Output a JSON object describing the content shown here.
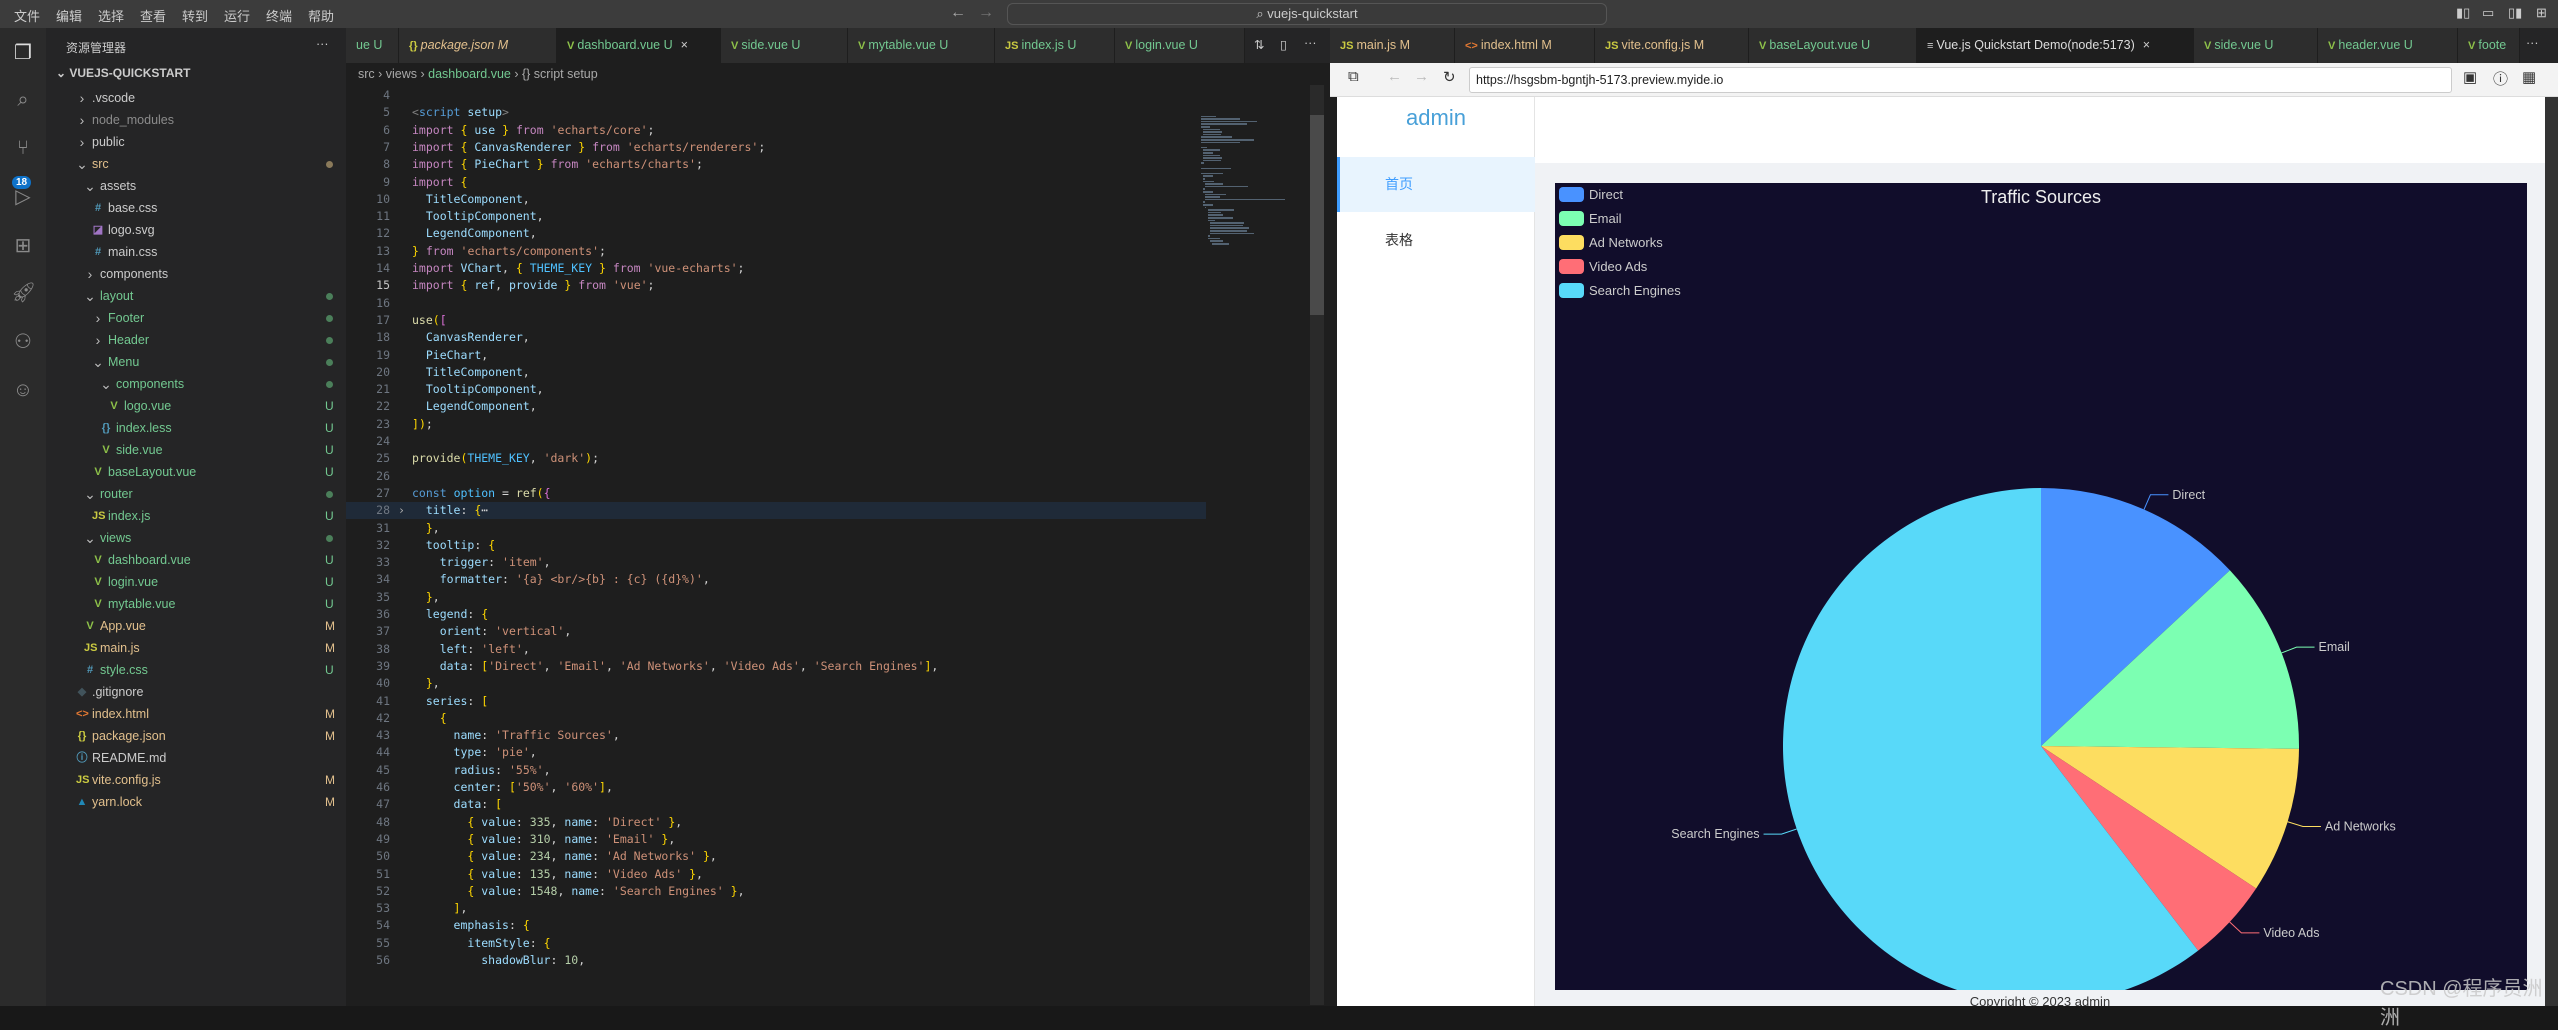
{
  "titlebar": {
    "menu": [
      "文件",
      "编辑",
      "选择",
      "查看",
      "转到",
      "运行",
      "终端",
      "帮助"
    ],
    "search": "vuejs-quickstart"
  },
  "activity_bar": {
    "scm_badge": "18"
  },
  "explorer": {
    "title": "资源管理器",
    "more": "···",
    "root": "VUEJS-QUICKSTART",
    "items": [
      {
        "name": ".vscode",
        "level": 1,
        "type": "folder",
        "open": false,
        "color": "default"
      },
      {
        "name": "node_modules",
        "level": 1,
        "type": "folder",
        "open": false,
        "color": "dim"
      },
      {
        "name": "public",
        "level": 1,
        "type": "folder",
        "open": false,
        "color": "default"
      },
      {
        "name": "src",
        "level": 1,
        "type": "folder",
        "open": true,
        "color": "o",
        "dot": "#8a7a5a"
      },
      {
        "name": "assets",
        "level": 2,
        "type": "folder",
        "open": true,
        "color": "default"
      },
      {
        "name": "base.css",
        "level": 3,
        "type": "file",
        "icon": "#",
        "iconColor": "#519aba",
        "color": "default"
      },
      {
        "name": "logo.svg",
        "level": 3,
        "type": "file",
        "icon": "◪",
        "iconColor": "#a074c4",
        "color": "default"
      },
      {
        "name": "main.css",
        "level": 3,
        "type": "file",
        "icon": "#",
        "iconColor": "#519aba",
        "color": "default"
      },
      {
        "name": "components",
        "level": 2,
        "type": "folder",
        "open": false,
        "color": "default"
      },
      {
        "name": "layout",
        "level": 2,
        "type": "folder",
        "open": true,
        "color": "g",
        "dot": "#4b7f5a"
      },
      {
        "name": "Footer",
        "level": 3,
        "type": "folder",
        "open": false,
        "color": "g",
        "dot": "#4b7f5a"
      },
      {
        "name": "Header",
        "level": 3,
        "type": "folder",
        "open": false,
        "color": "g",
        "dot": "#4b7f5a"
      },
      {
        "name": "Menu",
        "level": 3,
        "type": "folder",
        "open": true,
        "color": "g",
        "dot": "#4b7f5a"
      },
      {
        "name": "components",
        "level": 4,
        "type": "folder",
        "open": true,
        "color": "g",
        "dot": "#4b7f5a"
      },
      {
        "name": "logo.vue",
        "level": 5,
        "type": "file",
        "icon": "V",
        "iconColor": "#8dc149",
        "color": "g",
        "status": "U"
      },
      {
        "name": "index.less",
        "level": 4,
        "type": "file",
        "icon": "{}",
        "iconColor": "#519aba",
        "color": "g",
        "status": "U"
      },
      {
        "name": "side.vue",
        "level": 4,
        "type": "file",
        "icon": "V",
        "iconColor": "#8dc149",
        "color": "g",
        "status": "U"
      },
      {
        "name": "baseLayout.vue",
        "level": 3,
        "type": "file",
        "icon": "V",
        "iconColor": "#8dc149",
        "color": "g",
        "status": "U"
      },
      {
        "name": "router",
        "level": 2,
        "type": "folder",
        "open": true,
        "color": "g",
        "dot": "#4b7f5a"
      },
      {
        "name": "index.js",
        "level": 3,
        "type": "file",
        "icon": "JS",
        "iconColor": "#cbcb41",
        "color": "g",
        "status": "U"
      },
      {
        "name": "views",
        "level": 2,
        "type": "folder",
        "open": true,
        "color": "g",
        "dot": "#4b7f5a"
      },
      {
        "name": "dashboard.vue",
        "level": 3,
        "type": "file",
        "icon": "V",
        "iconColor": "#8dc149",
        "color": "g",
        "status": "U"
      },
      {
        "name": "login.vue",
        "level": 3,
        "type": "file",
        "icon": "V",
        "iconColor": "#8dc149",
        "color": "g",
        "status": "U"
      },
      {
        "name": "mytable.vue",
        "level": 3,
        "type": "file",
        "icon": "V",
        "iconColor": "#8dc149",
        "color": "g",
        "status": "U"
      },
      {
        "name": "App.vue",
        "level": 2,
        "type": "file",
        "icon": "V",
        "iconColor": "#8dc149",
        "color": "o",
        "status": "M"
      },
      {
        "name": "main.js",
        "level": 2,
        "type": "file",
        "icon": "JS",
        "iconColor": "#cbcb41",
        "color": "o",
        "status": "M"
      },
      {
        "name": "style.css",
        "level": 2,
        "type": "file",
        "icon": "#",
        "iconColor": "#519aba",
        "color": "g",
        "status": "U"
      },
      {
        "name": ".gitignore",
        "level": 1,
        "type": "file",
        "icon": "◆",
        "iconColor": "#41535b",
        "color": "default"
      },
      {
        "name": "index.html",
        "level": 1,
        "type": "file",
        "icon": "<>",
        "iconColor": "#e37933",
        "color": "o",
        "status": "M"
      },
      {
        "name": "package.json",
        "level": 1,
        "type": "file",
        "icon": "{}",
        "iconColor": "#cbcb41",
        "color": "o",
        "status": "M"
      },
      {
        "name": "README.md",
        "level": 1,
        "type": "file",
        "icon": "ⓘ",
        "iconColor": "#519aba",
        "color": "default"
      },
      {
        "name": "vite.config.js",
        "level": 1,
        "type": "file",
        "icon": "JS",
        "iconColor": "#cbcb41",
        "color": "o",
        "status": "M"
      },
      {
        "name": "yarn.lock",
        "level": 1,
        "type": "file",
        "icon": "▲",
        "iconColor": "#2188b6",
        "color": "o",
        "status": "M"
      }
    ]
  },
  "editor": {
    "tabs": [
      {
        "label": "ue U",
        "icon": "",
        "color": "g"
      },
      {
        "label": "package.json M",
        "icon": "{}",
        "color": "o",
        "italic": true
      },
      {
        "label": "dashboard.vue U",
        "icon": "V",
        "color": "g",
        "active": true,
        "close": "×"
      },
      {
        "label": "side.vue U",
        "icon": "V",
        "color": "g"
      },
      {
        "label": "mytable.vue U",
        "icon": "V",
        "color": "g"
      },
      {
        "label": "index.js U",
        "icon": "JS",
        "color": "g"
      },
      {
        "label": "login.vue U",
        "icon": "V",
        "color": "g"
      }
    ],
    "breadcrumb": [
      "src",
      "views",
      "dashboard.vue",
      "{} script setup"
    ],
    "lines": [
      {
        "n": 4,
        "t": ""
      },
      {
        "n": 5,
        "t": "<script setup>"
      },
      {
        "n": 6,
        "t": "import { use } from 'echarts/core';"
      },
      {
        "n": 7,
        "t": "import { CanvasRenderer } from 'echarts/renderers';"
      },
      {
        "n": 8,
        "t": "import { PieChart } from 'echarts/charts';"
      },
      {
        "n": 9,
        "t": "import {"
      },
      {
        "n": 10,
        "t": "  TitleComponent,"
      },
      {
        "n": 11,
        "t": "  TooltipComponent,"
      },
      {
        "n": 12,
        "t": "  LegendComponent,"
      },
      {
        "n": 13,
        "t": "} from 'echarts/components';"
      },
      {
        "n": 14,
        "t": "import VChart, { THEME_KEY } from 'vue-echarts';"
      },
      {
        "n": 15,
        "t": "import { ref, provide } from 'vue';"
      },
      {
        "n": 16,
        "t": ""
      },
      {
        "n": 17,
        "t": "use(["
      },
      {
        "n": 18,
        "t": "  CanvasRenderer,"
      },
      {
        "n": 19,
        "t": "  PieChart,"
      },
      {
        "n": 20,
        "t": "  TitleComponent,"
      },
      {
        "n": 21,
        "t": "  TooltipComponent,"
      },
      {
        "n": 22,
        "t": "  LegendComponent,"
      },
      {
        "n": 23,
        "t": "]);"
      },
      {
        "n": 24,
        "t": ""
      },
      {
        "n": 25,
        "t": "provide(THEME_KEY, 'dark');"
      },
      {
        "n": 26,
        "t": ""
      },
      {
        "n": 27,
        "t": "const option = ref({"
      },
      {
        "n": 28,
        "t": "  title: {⋯",
        "folded": true
      },
      {
        "n": 31,
        "t": "  },"
      },
      {
        "n": 32,
        "t": "  tooltip: {"
      },
      {
        "n": 33,
        "t": "    trigger: 'item',"
      },
      {
        "n": 34,
        "t": "    formatter: '{a} <br/>{b} : {c} ({d}%)',"
      },
      {
        "n": 35,
        "t": "  },"
      },
      {
        "n": 36,
        "t": "  legend: {"
      },
      {
        "n": 37,
        "t": "    orient: 'vertical',"
      },
      {
        "n": 38,
        "t": "    left: 'left',"
      },
      {
        "n": 39,
        "t": "    data: ['Direct', 'Email', 'Ad Networks', 'Video Ads', 'Search Engines'],"
      },
      {
        "n": 40,
        "t": "  },"
      },
      {
        "n": 41,
        "t": "  series: ["
      },
      {
        "n": 42,
        "t": "    {"
      },
      {
        "n": 43,
        "t": "      name: 'Traffic Sources',"
      },
      {
        "n": 44,
        "t": "      type: 'pie',"
      },
      {
        "n": 45,
        "t": "      radius: '55%',"
      },
      {
        "n": 46,
        "t": "      center: ['50%', '60%'],"
      },
      {
        "n": 47,
        "t": "      data: ["
      },
      {
        "n": 48,
        "t": "        { value: 335, name: 'Direct' },"
      },
      {
        "n": 49,
        "t": "        { value: 310, name: 'Email' },"
      },
      {
        "n": 50,
        "t": "        { value: 234, name: 'Ad Networks' },"
      },
      {
        "n": 51,
        "t": "        { value: 135, name: 'Video Ads' },"
      },
      {
        "n": 52,
        "t": "        { value: 1548, name: 'Search Engines' },"
      },
      {
        "n": 53,
        "t": "      ],"
      },
      {
        "n": 54,
        "t": "      emphasis: {"
      },
      {
        "n": 55,
        "t": "        itemStyle: {"
      },
      {
        "n": 56,
        "t": "          shadowBlur: 10,"
      }
    ]
  },
  "preview": {
    "tabs": [
      {
        "label": "main.js M",
        "icon": "JS",
        "color": "o"
      },
      {
        "label": "index.html M",
        "icon": "<>",
        "color": "o"
      },
      {
        "label": "vite.config.js M",
        "icon": "JS",
        "color": "o"
      },
      {
        "label": "baseLayout.vue U",
        "icon": "V",
        "color": "g"
      },
      {
        "label": "Vue.js Quickstart Demo(node:5173)",
        "icon": "≡",
        "color": "default",
        "active": true,
        "close": "×"
      },
      {
        "label": "side.vue U",
        "icon": "V",
        "color": "g"
      },
      {
        "label": "header.vue U",
        "icon": "V",
        "color": "g"
      },
      {
        "label": "foote",
        "icon": "V",
        "color": "g"
      }
    ],
    "more": "···",
    "url": "https://hsgsbm-bgntjh-5173.preview.myide.io",
    "app": {
      "logo": "admin",
      "menu": [
        {
          "label": "首页",
          "active": true
        },
        {
          "label": "表格",
          "active": false
        }
      ],
      "footer": "Copyright © 2023 admin"
    }
  },
  "watermark": "CSDN @程序员洲洲",
  "chart_data": {
    "type": "pie",
    "title": "Traffic Sources",
    "legend": {
      "orient": "vertical",
      "placement": "top-left"
    },
    "categories": [
      "Direct",
      "Email",
      "Ad Networks",
      "Video Ads",
      "Search Engines"
    ],
    "values": [
      335,
      310,
      234,
      135,
      1548
    ],
    "colors": [
      "#4992ff",
      "#7cffb2",
      "#fddd60",
      "#ff6e76",
      "#58d9f9"
    ],
    "background": "#100c2a"
  }
}
